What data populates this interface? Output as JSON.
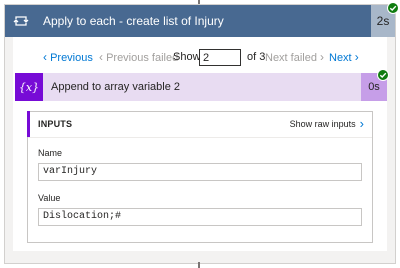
{
  "loop": {
    "title": "Apply to each - create list of Injury",
    "duration": "2s",
    "icon": "loop-icon",
    "status": "succeeded"
  },
  "pager": {
    "previous_label": "Previous",
    "previous_failed_label": "Previous failed",
    "show_label": "Show",
    "current_page": "2",
    "of_total": "of 3",
    "next_failed_label": "Next failed",
    "next_label": "Next"
  },
  "action": {
    "title": "Append to array variable 2",
    "duration": "0s",
    "icon_text": "{x}",
    "status": "succeeded"
  },
  "inputs": {
    "heading": "INPUTS",
    "show_raw_label": "Show raw inputs",
    "fields": [
      {
        "label": "Name",
        "value": "varInjury"
      },
      {
        "label": "Value",
        "value": "Dislocation;#"
      }
    ]
  },
  "colors": {
    "loop_header": "#486991",
    "action_icon": "#770bd6",
    "action_header": "#e8dcf2",
    "link": "#0078d4",
    "success": "#107c10"
  }
}
